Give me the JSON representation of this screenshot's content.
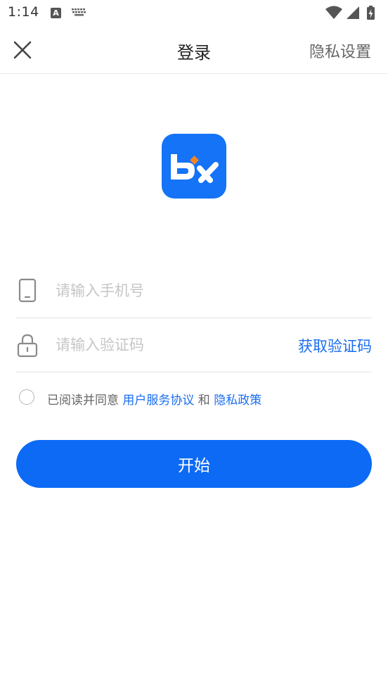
{
  "status_bar": {
    "time": "1:14",
    "icons": [
      "notification-a-icon",
      "keyboard-icon",
      "wifi-icon",
      "cell-signal-icon",
      "battery-charging-icon"
    ]
  },
  "header": {
    "title": "登录",
    "close_icon": "close-icon",
    "privacy_settings": "隐私设置"
  },
  "logo": {
    "icon": "app-logo-bx",
    "brand_color": "#1473f7",
    "accent_color": "#f5841f"
  },
  "form": {
    "phone": {
      "icon": "phone-icon",
      "placeholder": "请输入手机号",
      "value": ""
    },
    "code": {
      "icon": "lock-icon",
      "placeholder": "请输入验证码",
      "value": "",
      "get_code": "获取验证码"
    }
  },
  "agreement": {
    "checked": false,
    "prefix": "已阅读并同意 ",
    "user_agreement": "用户服务协议",
    "and": " 和 ",
    "privacy_policy": "隐私政策"
  },
  "start_button": {
    "label": "开始",
    "color": "#0c6af5"
  }
}
